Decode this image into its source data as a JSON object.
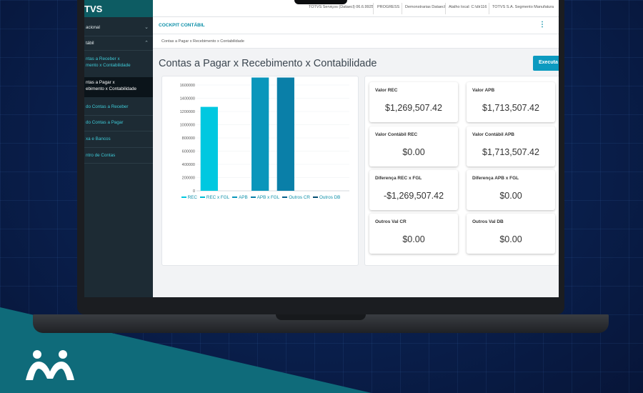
{
  "app": {
    "brand": "TVS",
    "status": [
      "TOTVS Serviços (Dataecl) 06.6.9925",
      "PROGRESS",
      "Demonstrarias Dataecl",
      "Atalho local: C:\\dir116",
      "TOTVS S.A. Segmento Manufatura"
    ]
  },
  "sidebar": {
    "items": [
      {
        "label": "acional",
        "type": "header"
      },
      {
        "label": "tábil",
        "type": "header"
      },
      {
        "label": "ntas a Receber x\nmento x Contabilidade",
        "type": "link"
      },
      {
        "label": "ntas a Pagar x\nebimento x Contabilidade",
        "type": "active"
      },
      {
        "label": "do Contas a Receber",
        "type": "link"
      },
      {
        "label": "do Contas a Pagar",
        "type": "link"
      },
      {
        "label": "xa e Bancos",
        "type": "link"
      },
      {
        "label": "ntro de Contas",
        "type": "link"
      }
    ]
  },
  "main": {
    "cockpit_title": "COCKPIT CONTÁBIL",
    "breadcrumb": "Contas a Pagar x Recebimento x Contabilidade",
    "page_title": "Contas a Pagar x Recebimento x Contabilidade",
    "execute_label": "Executa",
    "metrics": [
      {
        "label": "Valor REC",
        "value": "$1,269,507.42"
      },
      {
        "label": "Valor APB",
        "value": "$1,713,507.42"
      },
      {
        "label": "Valor Contábil REC",
        "value": "$0.00"
      },
      {
        "label": "Valor Contábil APB",
        "value": "$1,713,507.42"
      },
      {
        "label": "Diferença REC x FGL",
        "value": "-$1,269,507.42"
      },
      {
        "label": "Diferença APB x FGL",
        "value": "$0.00"
      },
      {
        "label": "Outros Val CR",
        "value": "$0.00"
      },
      {
        "label": "Outros Val DB",
        "value": "$0.00"
      }
    ]
  },
  "colors": {
    "accent": "#0c9ac0",
    "sidebar_bg": "#1d2b34",
    "series": [
      "#00c8e0",
      "#00bcd4",
      "#0a96bb",
      "#0a7fa8",
      "#07608a",
      "#054e72"
    ]
  },
  "chart_data": {
    "type": "bar",
    "categories": [
      "REC",
      "REC x FGL",
      "APB",
      "APB x FGL",
      "Outros CR",
      "Outros DB"
    ],
    "values": [
      1269507.42,
      0,
      1713507.42,
      1713507.42,
      0,
      0
    ],
    "yticks": [
      "0",
      "200000",
      "400000",
      "600000",
      "800000",
      "1000000",
      "1200000",
      "1400000",
      "1600000"
    ],
    "ylim": [
      0,
      1600000
    ],
    "legend": [
      "REC",
      "REC x FGL",
      "APB",
      "APB x FGL",
      "Outros CR",
      "Outros DB"
    ],
    "legend_position": "bottom",
    "grid": true
  }
}
